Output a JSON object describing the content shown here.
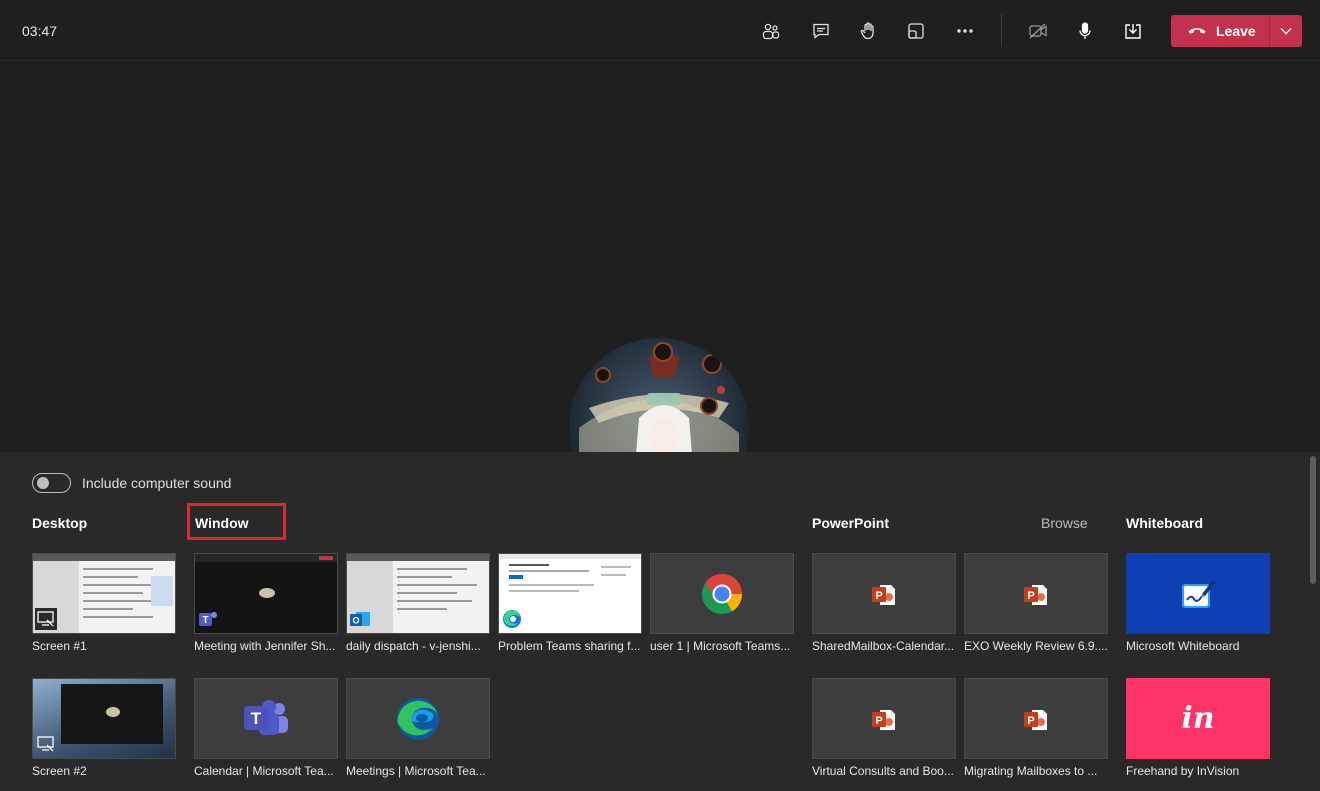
{
  "topbar": {
    "timer": "03:47",
    "leave_label": "Leave"
  },
  "icons": {
    "people": "people-icon",
    "chat": "chat-icon",
    "raise_hand": "raise-hand-icon",
    "rooms": "rooms-icon",
    "more": "more-icon",
    "camera_off": "camera-off-icon",
    "mic": "mic-icon",
    "share": "share-tray-icon",
    "hangup": "phone-hangup-icon"
  },
  "colors": {
    "leave": "#c4314b",
    "highlight": "#e3242b",
    "whiteboard": "#0f3fb4",
    "invision": "#ff3366"
  },
  "tray": {
    "include_sound": "Include computer sound",
    "include_sound_on": false,
    "sections": {
      "desktop": "Desktop",
      "window": "Window",
      "powerpoint": "PowerPoint",
      "browse": "Browse",
      "whiteboard": "Whiteboard"
    },
    "desktop": [
      "Screen #1",
      "Screen #2"
    ],
    "windows": [
      "Meeting with Jennifer Sh...",
      "daily dispatch - v-jenshi...",
      "Problem Teams sharing f...",
      "user 1 | Microsoft Teams...",
      "Calendar | Microsoft Tea...",
      "Meetings | Microsoft Tea..."
    ],
    "powerpoint": [
      "SharedMailbox-Calendar...",
      "EXO Weekly Review 6.9....",
      "Virtual Consults and Boo...",
      "Migrating Mailboxes to ..."
    ],
    "whiteboards": [
      "Microsoft Whiteboard",
      "Freehand by InVision"
    ],
    "invision_logo": "in"
  }
}
